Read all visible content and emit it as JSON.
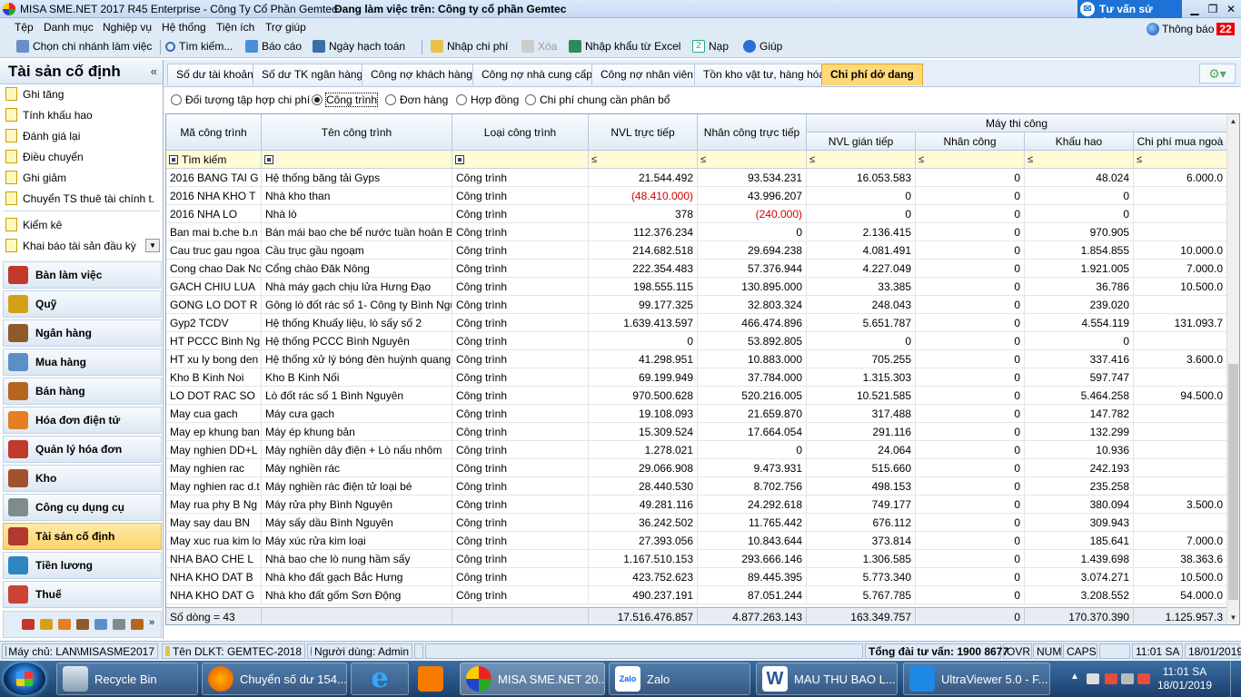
{
  "app": {
    "title": "MISA SME.NET 2017 R45 Enterprise - Công Ty Cổ Phần Gemtec",
    "working_on": "Đang làm việc trên: Công ty cổ phần Gemtec",
    "advice_button": "Tư vấn sử dụng"
  },
  "menu": [
    "Tệp",
    "Danh mục",
    "Nghiệp vụ",
    "Hệ thống",
    "Tiện ích",
    "Trợ giúp"
  ],
  "toolbar": {
    "branch": "Chọn chi nhánh làm việc",
    "search": "Tìm kiếm...",
    "report": "Báo cáo",
    "accounting_date": "Ngày hạch toán",
    "import_cost": "Nhập chi phí",
    "delete": "Xóa",
    "import_excel": "Nhập khẩu từ Excel",
    "save": "Nạp",
    "help": "Giúp"
  },
  "notice": {
    "label": "Thông báo",
    "count": "22"
  },
  "sidebar": {
    "title": "Tài sản cố định",
    "items": [
      "Ghi tăng",
      "Tính khấu hao",
      "Đánh giá lại",
      "Điều chuyển",
      "Ghi giảm",
      "Chuyển TS thuê tài chính t...",
      "Kiểm kê",
      "Khai báo tài sản đầu kỳ"
    ],
    "modules": [
      {
        "label": "Bàn làm việc",
        "color": "#c0392b"
      },
      {
        "label": "Quỹ",
        "color": "#d4a017"
      },
      {
        "label": "Ngân hàng",
        "color": "#8e5a2b"
      },
      {
        "label": "Mua hàng",
        "color": "#5d8fc7"
      },
      {
        "label": "Bán hàng",
        "color": "#b5651d"
      },
      {
        "label": "Hóa đơn điện tử",
        "color": "#e67e22"
      },
      {
        "label": "Quản lý hóa đơn",
        "color": "#c0392b"
      },
      {
        "label": "Kho",
        "color": "#a0522d"
      },
      {
        "label": "Công cụ dụng cụ",
        "color": "#7f8c8d"
      },
      {
        "label": "Tài sản cố định",
        "color": "#b03a2e"
      },
      {
        "label": "Tiền lương",
        "color": "#2e86c1"
      },
      {
        "label": "Thuế",
        "color": "#cb4335"
      }
    ]
  },
  "tabs": [
    "Số dư tài khoản",
    "Số dư TK ngân hàng",
    "Công nợ khách hàng",
    "Công nợ nhà cung cấp",
    "Công nợ nhân viên",
    "Tồn kho vật tư, hàng hóa",
    "Chi phí dở dang"
  ],
  "selected_tab": "Chi phí dở dang",
  "radios": [
    "Đối tượng tập hợp chi phí",
    "Công trình",
    "Đơn hàng",
    "Hợp đồng",
    "Chi phí chung cần phân bổ"
  ],
  "selected_radio": "Công trình",
  "grid": {
    "headers": {
      "code": "Mã công trình",
      "name": "Tên công trình",
      "type": "Loại công trình",
      "nvl": "NVL trực tiếp",
      "nc": "Nhân công trực tiếp",
      "group": "Máy thi công",
      "nvlgt": "NVL gián tiếp",
      "ncm": "Nhân công",
      "kh": "Khấu hao",
      "cpm": "Chi phí mua ngoà"
    },
    "filter": {
      "search": "Tìm kiếm",
      "le": "≤"
    },
    "rows": [
      [
        "2016 BANG TAI G",
        "Hệ thống băng tải Gyps",
        "Công trình",
        "21.544.492",
        "93.534.231",
        "16.053.583",
        "0",
        "48.024",
        "6.000.0"
      ],
      [
        "2016 NHA KHO T",
        "Nhà kho than",
        "Công trình",
        "(48.410.000)",
        "43.996.207",
        "0",
        "0",
        "0",
        ""
      ],
      [
        "2016 NHA LO",
        "Nhà lò",
        "Công trình",
        "378",
        "(240.000)",
        "0",
        "0",
        "0",
        ""
      ],
      [
        "Ban mai b.che b.n",
        "Bán mái bao che bể nước tuần hoàn BN",
        "Công trình",
        "112.376.234",
        "0",
        "2.136.415",
        "0",
        "970.905",
        ""
      ],
      [
        "Cau truc gau ngoa",
        "Cầu trục gầu ngoạm",
        "Công trình",
        "214.682.518",
        "29.694.238",
        "4.081.491",
        "0",
        "1.854.855",
        "10.000.0"
      ],
      [
        "Cong chao Dak No",
        "Cổng chào Đăk Nông",
        "Công trình",
        "222.354.483",
        "57.376.944",
        "4.227.049",
        "0",
        "1.921.005",
        "7.000.0"
      ],
      [
        "GACH CHIU LUA",
        "Nhà máy gạch chịu lửa Hưng Đạo",
        "Công trình",
        "198.555.115",
        "130.895.000",
        "33.385",
        "0",
        "36.786",
        "10.500.0"
      ],
      [
        "GONG LO DOT R",
        "Gông lò đốt rác số 1- Công ty Bình Ngu",
        "Công trình",
        "99.177.325",
        "32.803.324",
        "248.043",
        "0",
        "239.020",
        ""
      ],
      [
        "Gyp2 TCDV",
        "Hệ thống Khuấy liệu, lò sấy số 2",
        "Công trình",
        "1.639.413.597",
        "466.474.896",
        "5.651.787",
        "0",
        "4.554.119",
        "131.093.7"
      ],
      [
        "HT PCCC Binh Ng",
        "Hệ thống PCCC Bình Nguyên",
        "Công trình",
        "0",
        "53.892.805",
        "0",
        "0",
        "0",
        ""
      ],
      [
        "HT xu ly bong den",
        "Hệ thống xử lý bóng đèn huỳnh quang B",
        "Công trình",
        "41.298.951",
        "10.883.000",
        "705.255",
        "0",
        "337.416",
        "3.600.0"
      ],
      [
        "Kho B Kinh Noi",
        "Kho B Kinh Nối",
        "Công trình",
        "69.199.949",
        "37.784.000",
        "1.315.303",
        "0",
        "597.747",
        ""
      ],
      [
        "LO DOT RAC SO",
        "Lò đốt rác số 1 Bình Nguyên",
        "Công trình",
        "970.500.628",
        "520.216.005",
        "10.521.585",
        "0",
        "5.464.258",
        "94.500.0"
      ],
      [
        "May cua gach",
        "Máy cưa gạch",
        "Công trình",
        "19.108.093",
        "21.659.870",
        "317.488",
        "0",
        "147.782",
        ""
      ],
      [
        "May ep khung ban",
        "Máy ép khung bản",
        "Công trình",
        "15.309.524",
        "17.664.054",
        "291.116",
        "0",
        "132.299",
        ""
      ],
      [
        "May nghien DD+L",
        "Máy nghiền dây điện + Lò nấu nhôm",
        "Công trình",
        "1.278.021",
        "0",
        "24.064",
        "0",
        "10.936",
        ""
      ],
      [
        "May nghien rac",
        "Máy nghiền rác",
        "Công trình",
        "29.066.908",
        "9.473.931",
        "515.660",
        "0",
        "242.193",
        ""
      ],
      [
        "May nghien rac d.t",
        "Máy nghiền rác điện tử loại bé",
        "Công trình",
        "28.440.530",
        "8.702.756",
        "498.153",
        "0",
        "235.258",
        ""
      ],
      [
        "May rua phy B Ng",
        "Máy rửa phy Bình Nguyên",
        "Công trình",
        "49.281.116",
        "24.292.618",
        "749.177",
        "0",
        "380.094",
        "3.500.0"
      ],
      [
        "May say dau BN",
        "Máy sấy dầu Bình Nguyên",
        "Công trình",
        "36.242.502",
        "11.765.442",
        "676.112",
        "0",
        "309.943",
        ""
      ],
      [
        "May xuc rua kim lo",
        "Máy xúc rửa kim loại",
        "Công trình",
        "27.393.056",
        "10.843.644",
        "373.814",
        "0",
        "185.641",
        "7.000.0"
      ],
      [
        "NHA BAO CHE L",
        "Nhà bao che lò nung hầm sấy",
        "Công trình",
        "1.167.510.153",
        "293.666.146",
        "1.306.585",
        "0",
        "1.439.698",
        "38.363.6"
      ],
      [
        "NHA KHO DAT B",
        "Nhà kho đất gạch Bắc Hưng",
        "Công trình",
        "423.752.623",
        "89.445.395",
        "5.773.340",
        "0",
        "3.074.271",
        "10.500.0"
      ],
      [
        "NHA KHO DAT G",
        "Nhà kho đất gốm Sơn Động",
        "Công trình",
        "490.237.191",
        "87.051.244",
        "5.767.785",
        "0",
        "3.208.552",
        "54.000.0"
      ]
    ],
    "footer": [
      "Số dòng = 43",
      "",
      "",
      "17.516.476.857",
      "4.877.263.143",
      "163.349.757",
      "0",
      "170.370.390",
      "1.125.957.3"
    ]
  },
  "statusbar": {
    "server": "Máy chủ: LAN\\MISASME2017",
    "dataset": "Tên DLKT: GEMTEC-2018",
    "user": "Người dùng: Admin",
    "hotline": "Tổng đài tư vấn: 1900 8677",
    "ovr": "OVR",
    "num": "NUM",
    "caps": "CAPS",
    "time": "11:01 SA",
    "date": "18/01/2019"
  },
  "taskbar": {
    "items": [
      "Recycle Bin",
      "Chuyển số dư 154...",
      "",
      "",
      "MISA SME.NET 20...",
      "Zalo",
      "MAU THU BAO L...",
      "UltraViewer 5.0 - F..."
    ],
    "clock_time": "11:01 SA",
    "clock_date": "18/01/2019"
  }
}
